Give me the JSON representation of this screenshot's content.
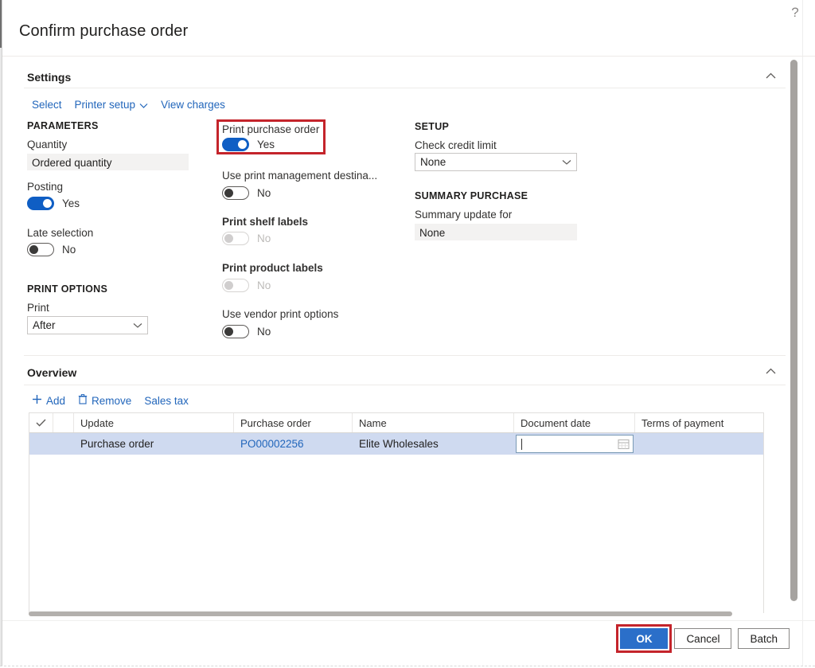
{
  "window": {
    "help_icon": "question-mark-icon",
    "title": "Confirm purchase order"
  },
  "settings": {
    "heading": "Settings",
    "collapse_icon": "chevron-up-icon",
    "commands": [
      {
        "label": "Select",
        "icon": null
      },
      {
        "label": "Printer setup",
        "icon": "chevron-down-icon"
      },
      {
        "label": "View charges",
        "icon": null
      }
    ],
    "parameters": {
      "group_title": "PARAMETERS",
      "quantity_label": "Quantity",
      "quantity_value": "Ordered quantity",
      "posting_label": "Posting",
      "posting_value": "Yes",
      "posting_state": "on",
      "late_selection_label": "Late selection",
      "late_selection_value": "No",
      "late_selection_state": "off"
    },
    "print_options": {
      "group_title": "PRINT OPTIONS",
      "print_label": "Print",
      "print_value": "After",
      "print_chevron": "chevron-down-icon"
    },
    "middle_column": {
      "print_purchase_order_label": "Print purchase order",
      "print_purchase_order_value": "Yes",
      "print_purchase_order_state": "on",
      "use_print_management_label": "Use print management destina...",
      "use_print_management_value": "No",
      "use_print_management_state": "off",
      "print_shelf_labels_label": "Print shelf labels",
      "print_shelf_labels_value": "No",
      "print_shelf_labels_state": "off-disabled",
      "print_product_labels_label": "Print product labels",
      "print_product_labels_value": "No",
      "print_product_labels_state": "off-disabled",
      "use_vendor_print_options_label": "Use vendor print options",
      "use_vendor_print_options_value": "No",
      "use_vendor_print_options_state": "off"
    },
    "right_column": {
      "setup_title": "SETUP",
      "check_credit_limit_label": "Check credit limit",
      "check_credit_limit_value": "None",
      "check_credit_limit_chevron": "chevron-down-icon",
      "summary_purchase_title": "SUMMARY PURCHASE",
      "summary_update_for_label": "Summary update for",
      "summary_update_for_value": "None"
    }
  },
  "overview": {
    "heading": "Overview",
    "collapse_icon": "chevron-up-icon",
    "commands": [
      {
        "label": "Add",
        "icon": "plus-icon"
      },
      {
        "label": "Remove",
        "icon": "trash-icon"
      },
      {
        "label": "Sales tax",
        "icon": null
      }
    ],
    "grid": {
      "select_all_icon": "checkmark-icon",
      "columns": [
        "Update",
        "Purchase order",
        "Name",
        "Document date",
        "Terms of payment"
      ],
      "rows": [
        {
          "update": "Purchase order",
          "purchase_order": "PO00002256",
          "name": "Elite Wholesales",
          "document_date": "",
          "document_date_icon": "calendar-icon",
          "terms_of_payment": ""
        }
      ]
    }
  },
  "footer": {
    "ok_label": "OK",
    "cancel_label": "Cancel",
    "batch_label": "Batch"
  },
  "colors": {
    "accent_blue": "#0f5ec4",
    "primary_button": "#2b6fc9",
    "link_blue": "#2266bb",
    "highlight_red": "#c4242b",
    "row_selected": "#cfdaf0"
  }
}
